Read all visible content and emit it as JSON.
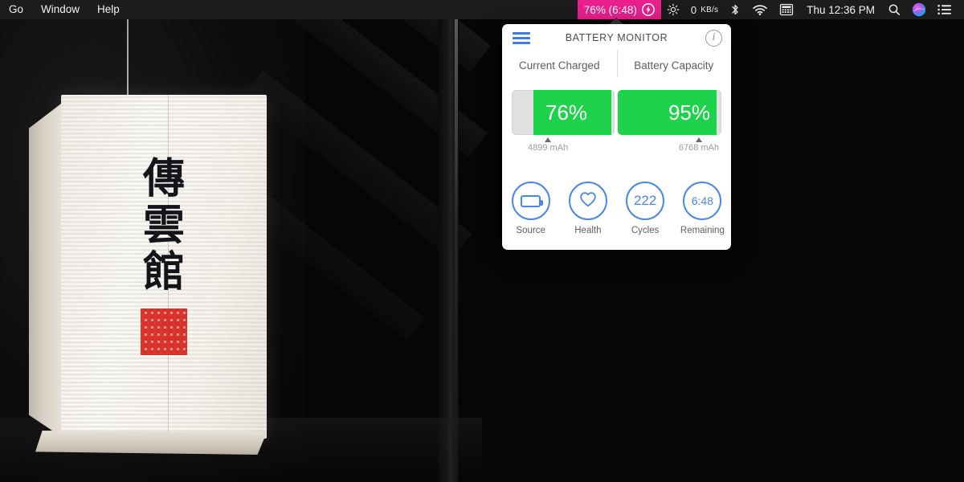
{
  "menubar": {
    "app_menus": [
      {
        "label": "Go",
        "name": "menu-go"
      },
      {
        "label": "Window",
        "name": "menu-window"
      },
      {
        "label": "Help",
        "name": "menu-help"
      }
    ],
    "battery_status": {
      "label": "76% (6:48)",
      "icon": "lightning-bolt-icon",
      "highlight_color": "#e81f8c",
      "text_color": "#ffffff"
    },
    "brightness_icon": "brightness-icon",
    "network_speed": "0",
    "network_speed_unit": "KB/s",
    "bluetooth_icon": "bluetooth-icon",
    "wifi_icon": "wifi-icon",
    "calculator_icon": "calculator-icon",
    "clock": "Thu 12:36 PM",
    "search_icon": "search-icon",
    "siri_icon": "siri-icon",
    "control_center_icon": "list-menu-icon"
  },
  "popup": {
    "title": "BATTERY MONITOR",
    "menu_icon": "hamburger-menu-icon",
    "info_icon": "info-icon",
    "info_glyph": "i",
    "columns": [
      {
        "label": "Current Charged"
      },
      {
        "label": "Battery Capacity"
      }
    ],
    "bars": [
      {
        "name": "current-charged-bar",
        "percent_label": "76%",
        "percent_value": 76,
        "mah_label": "4899 mAh",
        "fill_color": "#1ed34b",
        "track_color": "#dfe0e2"
      },
      {
        "name": "battery-capacity-bar",
        "percent_label": "95%",
        "percent_value": 95,
        "mah_label": "6768 mAh",
        "fill_color": "#1ed34b",
        "track_color": "#dfe0e2"
      }
    ],
    "stats": [
      {
        "label": "Source",
        "value": "",
        "icon": "battery-icon",
        "name": "stat-source"
      },
      {
        "label": "Health",
        "value": "",
        "icon": "heart-icon",
        "name": "stat-health"
      },
      {
        "label": "Cycles",
        "value": "222",
        "icon": "",
        "name": "stat-cycles"
      },
      {
        "label": "Remaining",
        "value": "6:48",
        "icon": "",
        "name": "stat-remaining"
      }
    ],
    "accent_color": "#4a86e8"
  },
  "desktop": {
    "wallpaper_subject": "white paper lantern",
    "lantern_characters": [
      "傳",
      "雲",
      "館"
    ],
    "lantern_seal": "red seal stamp"
  }
}
